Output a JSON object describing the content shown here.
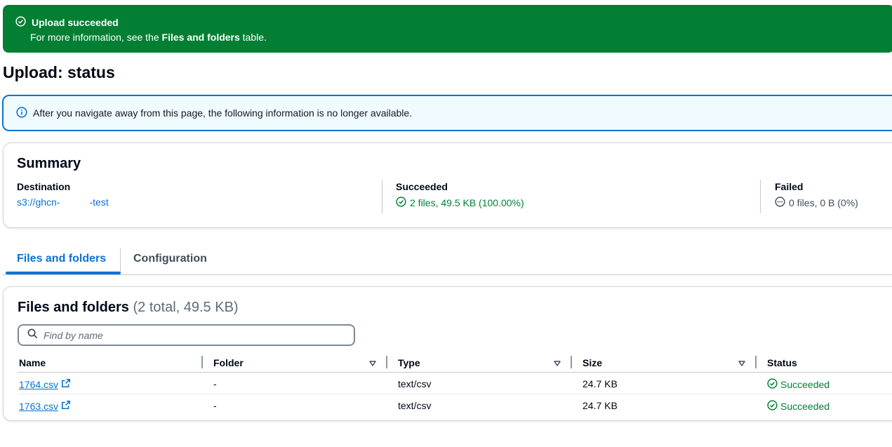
{
  "flash": {
    "title": "Upload succeeded",
    "message_prefix": "For more information, see the ",
    "message_bold": "Files and folders",
    "message_suffix": " table."
  },
  "page": {
    "title": "Upload: status"
  },
  "info": {
    "text": "After you navigate away from this page, the following information is no longer available."
  },
  "summary": {
    "title": "Summary",
    "destination": {
      "label": "Destination",
      "value_a": "s3://ghcn-",
      "value_b": "-test"
    },
    "succeeded": {
      "label": "Succeeded",
      "value": "2 files, 49.5 KB (100.00%)"
    },
    "failed": {
      "label": "Failed",
      "value": "0 files, 0 B (0%)"
    }
  },
  "tabs": [
    {
      "label": "Files and folders",
      "active": true
    },
    {
      "label": "Configuration",
      "active": false
    }
  ],
  "files": {
    "title": "Files and folders",
    "count": "(2 total, 49.5 KB)",
    "search_placeholder": "Find by name",
    "columns": [
      "Name",
      "Folder",
      "Type",
      "Size",
      "Status"
    ],
    "rows": [
      {
        "name": "1764.csv",
        "folder": "-",
        "type": "text/csv",
        "size": "24.7 KB",
        "status": "Succeeded"
      },
      {
        "name": "1763.csv",
        "folder": "-",
        "type": "text/csv",
        "size": "24.7 KB",
        "status": "Succeeded"
      }
    ]
  },
  "colors": {
    "success": "#037f34",
    "link": "#0972d3",
    "info_bg": "#f0fbff"
  }
}
